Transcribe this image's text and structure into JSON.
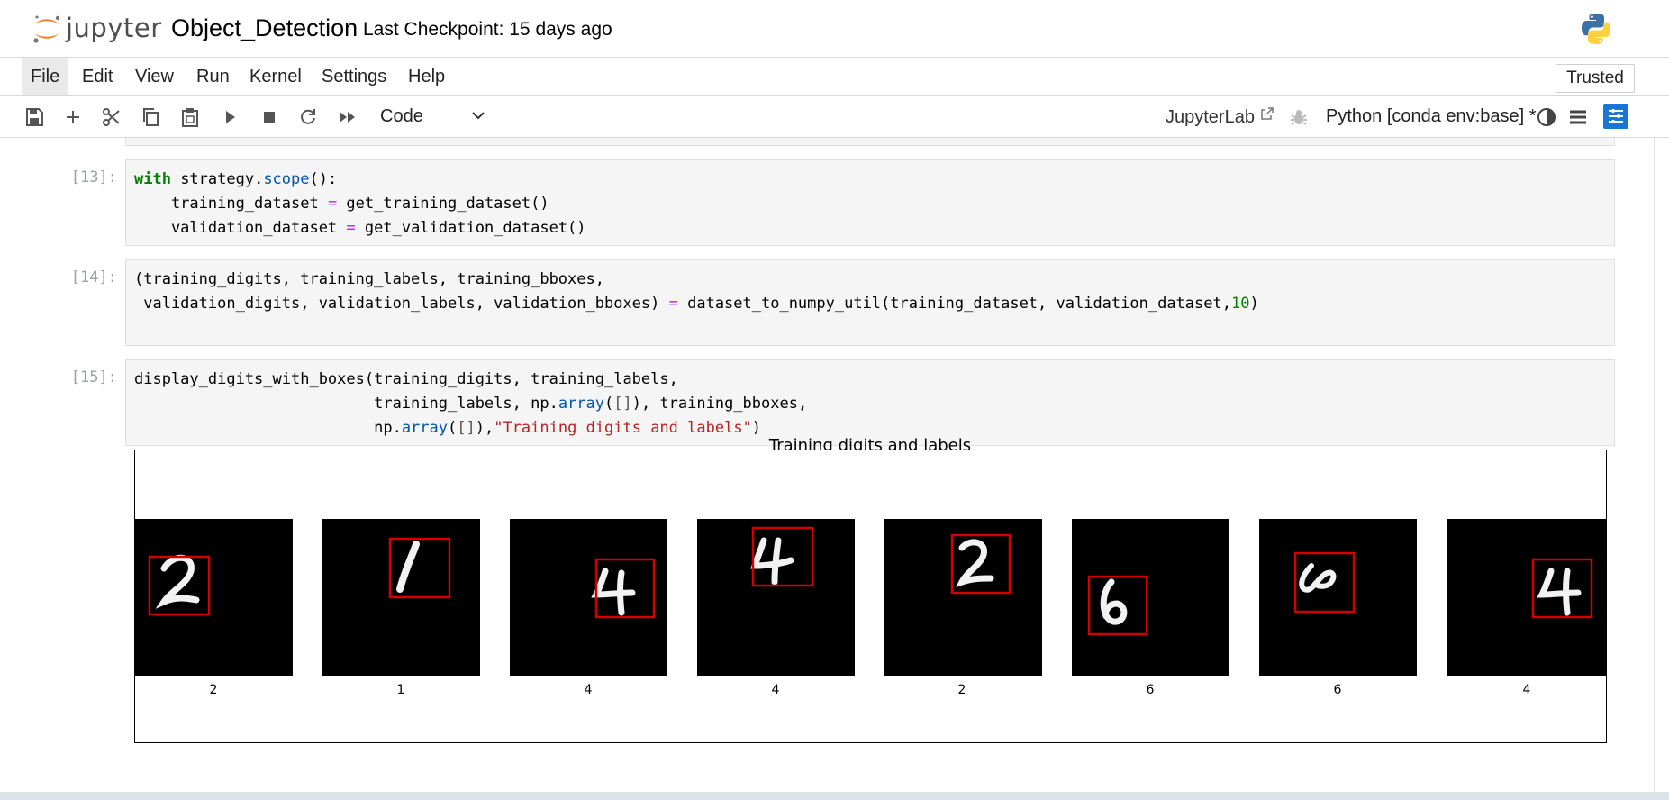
{
  "header": {
    "logo_text": "jupyter",
    "notebook_title": "Object_Detection",
    "checkpoint": "Last Checkpoint: 15 days ago"
  },
  "menu": {
    "items": [
      "File",
      "Edit",
      "View",
      "Run",
      "Kernel",
      "Settings",
      "Help"
    ],
    "active": "File",
    "trusted_label": "Trusted"
  },
  "toolbar": {
    "icons": [
      "save-icon",
      "add-cell-icon",
      "cut-icon",
      "copy-icon",
      "paste-icon",
      "run-icon",
      "stop-icon",
      "restart-icon",
      "fast-forward-icon"
    ],
    "cell_type": "Code",
    "jupyterlab_label": "JupyterLab",
    "kernel_name": "Python [conda env:base] *"
  },
  "cells": [
    {
      "prompt": "[13]:",
      "lines": [
        "with strategy.scope():",
        "    training_dataset = get_training_dataset()",
        "    validation_dataset = get_validation_dataset()"
      ]
    },
    {
      "prompt": "[14]:",
      "lines": [
        "(training_digits, training_labels, training_bboxes,",
        " validation_digits, validation_labels, validation_bboxes) = dataset_to_numpy_util(training_dataset, validation_dataset,10)"
      ]
    },
    {
      "prompt": "[15]:",
      "lines": [
        "display_digits_with_boxes(training_digits, training_labels,",
        "                          training_labels, np.array([]), training_bboxes,",
        "                          np.array([]),\"Training digits and labels\")"
      ]
    }
  ],
  "figure": {
    "title": "Training digits and labels",
    "labels": [
      "2",
      "1",
      "4",
      "4",
      "2",
      "6",
      "6",
      "4"
    ],
    "box_color": "#d40000"
  }
}
